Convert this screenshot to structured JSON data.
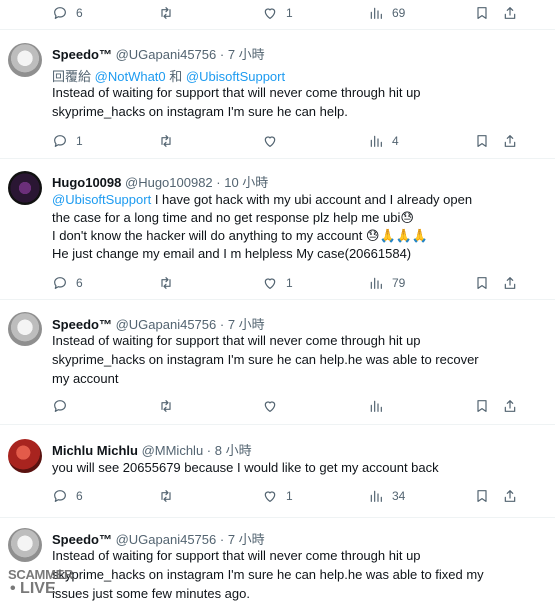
{
  "top_actions": {
    "replies": "6",
    "retweets": "",
    "likes": "1",
    "views": "69"
  },
  "tweets": [
    {
      "name": "Speedo™",
      "handle": "@UGapani45756",
      "time": "· 7 小時",
      "reply_prefix": "回覆給",
      "reply_to1": "@NotWhat0",
      "reply_and": "和",
      "reply_to2": "@UbisoftSupport",
      "lines": [
        "Instead of waiting for support that will never come through hit up",
        "skyprime_hacks on instagram I'm sure he can help."
      ],
      "actions": {
        "replies": "1",
        "retweets": "",
        "likes": "",
        "views": "4"
      }
    },
    {
      "name": "Hugo10098",
      "handle": "@Hugo100982",
      "time": "· 10 小時",
      "mention": "@UbisoftSupport",
      "lines": [
        "I have got hack with my ubi account and I already open",
        "the case for a long time and no get response plz help me ubi😓",
        "I don't know the hacker will do anything to my account 😓🙏🙏🙏",
        "He just change my email and I m helpless My case(20661584)"
      ],
      "actions": {
        "replies": "6",
        "retweets": "",
        "likes": "1",
        "views": "79"
      }
    },
    {
      "name": "Speedo™",
      "handle": "@UGapani45756",
      "time": "· 7 小時",
      "lines": [
        "Instead of waiting for support that will never come through hit up",
        "skyprime_hacks on instagram I'm sure he can help.he was able to recover",
        "my account"
      ],
      "actions": {
        "replies": "",
        "retweets": "",
        "likes": "",
        "views": ""
      }
    },
    {
      "name": "Michlu Michlu",
      "handle": "@MMichlu",
      "time": "· 8 小時",
      "lines": [
        "you will see 20655679 because I would like to get my account back"
      ],
      "actions": {
        "replies": "6",
        "retweets": "",
        "likes": "1",
        "views": "34"
      }
    },
    {
      "name": "Speedo™",
      "handle": "@UGapani45756",
      "time": "· 7 小時",
      "lines": [
        "Instead of waiting for support that will never come through hit up",
        "skyprime_hacks on instagram I'm sure he can help.he was able to fixed my",
        "issues just some few minutes ago."
      ]
    }
  ],
  "watermark": {
    "line1": "SCAMMER",
    "line2": "LIVE"
  }
}
